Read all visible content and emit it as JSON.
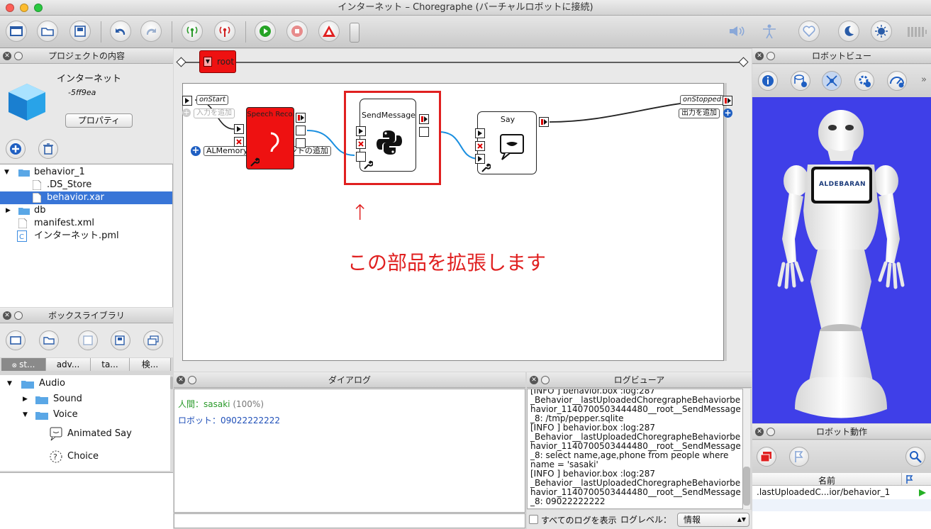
{
  "window": {
    "title": "インターネット – Choregraphe (バーチャルロボットに接続)"
  },
  "project_panel": {
    "title": "プロジェクトの内容",
    "project_name": "インターネット",
    "project_id": "-5ff9ea",
    "properties_button": "プロパティ",
    "tree": [
      {
        "label": "behavior_1",
        "type": "folder",
        "expanded": true
      },
      {
        "label": ".DS_Store",
        "type": "file"
      },
      {
        "label": "behavior.xar",
        "type": "file",
        "selected": true
      },
      {
        "label": "db",
        "type": "folder",
        "expanded": false
      },
      {
        "label": "manifest.xml",
        "type": "file"
      },
      {
        "label": "インターネット.pml",
        "type": "pml"
      }
    ]
  },
  "box_library": {
    "title": "ボックスライブラリ",
    "tabs": [
      "st...",
      "adv...",
      "ta...",
      "検..."
    ],
    "tree": [
      {
        "label": "Audio"
      },
      {
        "label": "Sound"
      },
      {
        "label": "Voice"
      },
      {
        "label": "Animated Say"
      },
      {
        "label": "Choice"
      }
    ]
  },
  "canvas": {
    "breadcrumb": "root",
    "input_label": "onStart",
    "add_input": "入力を追加",
    "output_label": "onStopped",
    "add_output": "出力を追加",
    "almemory_label": "ALMemory からのイベントの追加",
    "boxes": {
      "speech": "Speech Reco.",
      "send": "SendMessage",
      "say": "Say"
    },
    "annotation_arrow": "↑",
    "annotation_text": "この部品を拡張します"
  },
  "dialog_panel": {
    "title": "ダイアログ",
    "human_prefix": "人間：",
    "human_name": "sasaki",
    "human_conf": "(100%)",
    "robot_prefix": "ロボット：",
    "robot_reply": "09022222222"
  },
  "log_panel": {
    "title": "ログビューア",
    "lines": [
      "[INFO ] behavior.box :log:287",
      "_Behavior__lastUploadedChoregrapheBehaviorbe",
      "havior_1140700503444480__root__SendMessage",
      "_8: /tmp/pepper.sqlite",
      "[INFO ] behavior.box :log:287",
      "_Behavior__lastUploadedChoregrapheBehaviorbe",
      "havior_1140700503444480__root__SendMessage",
      "_8: select name,age,phone from people where",
      "name = 'sasaki'",
      "[INFO ] behavior.box :log:287",
      "_Behavior__lastUploadedChoregrapheBehaviorbe",
      "havior_1140700503444480__root__SendMessage",
      "_8: 09022222222"
    ],
    "show_all_label": "すべてのログを表示",
    "level_label": "ログレベル：",
    "level_value": "情報"
  },
  "robot_view": {
    "title": "ロボットビュー",
    "brand": "ALDEBARAN"
  },
  "robot_actions": {
    "title": "ロボット動作",
    "column_name": "名前",
    "row": ".lastUploadedC...ior/behavior_1"
  },
  "colors": {
    "accent_red": "#e02020",
    "box_red": "#ee1111",
    "select_blue": "#3875d7",
    "robot_bg": "#3f3fe8"
  }
}
